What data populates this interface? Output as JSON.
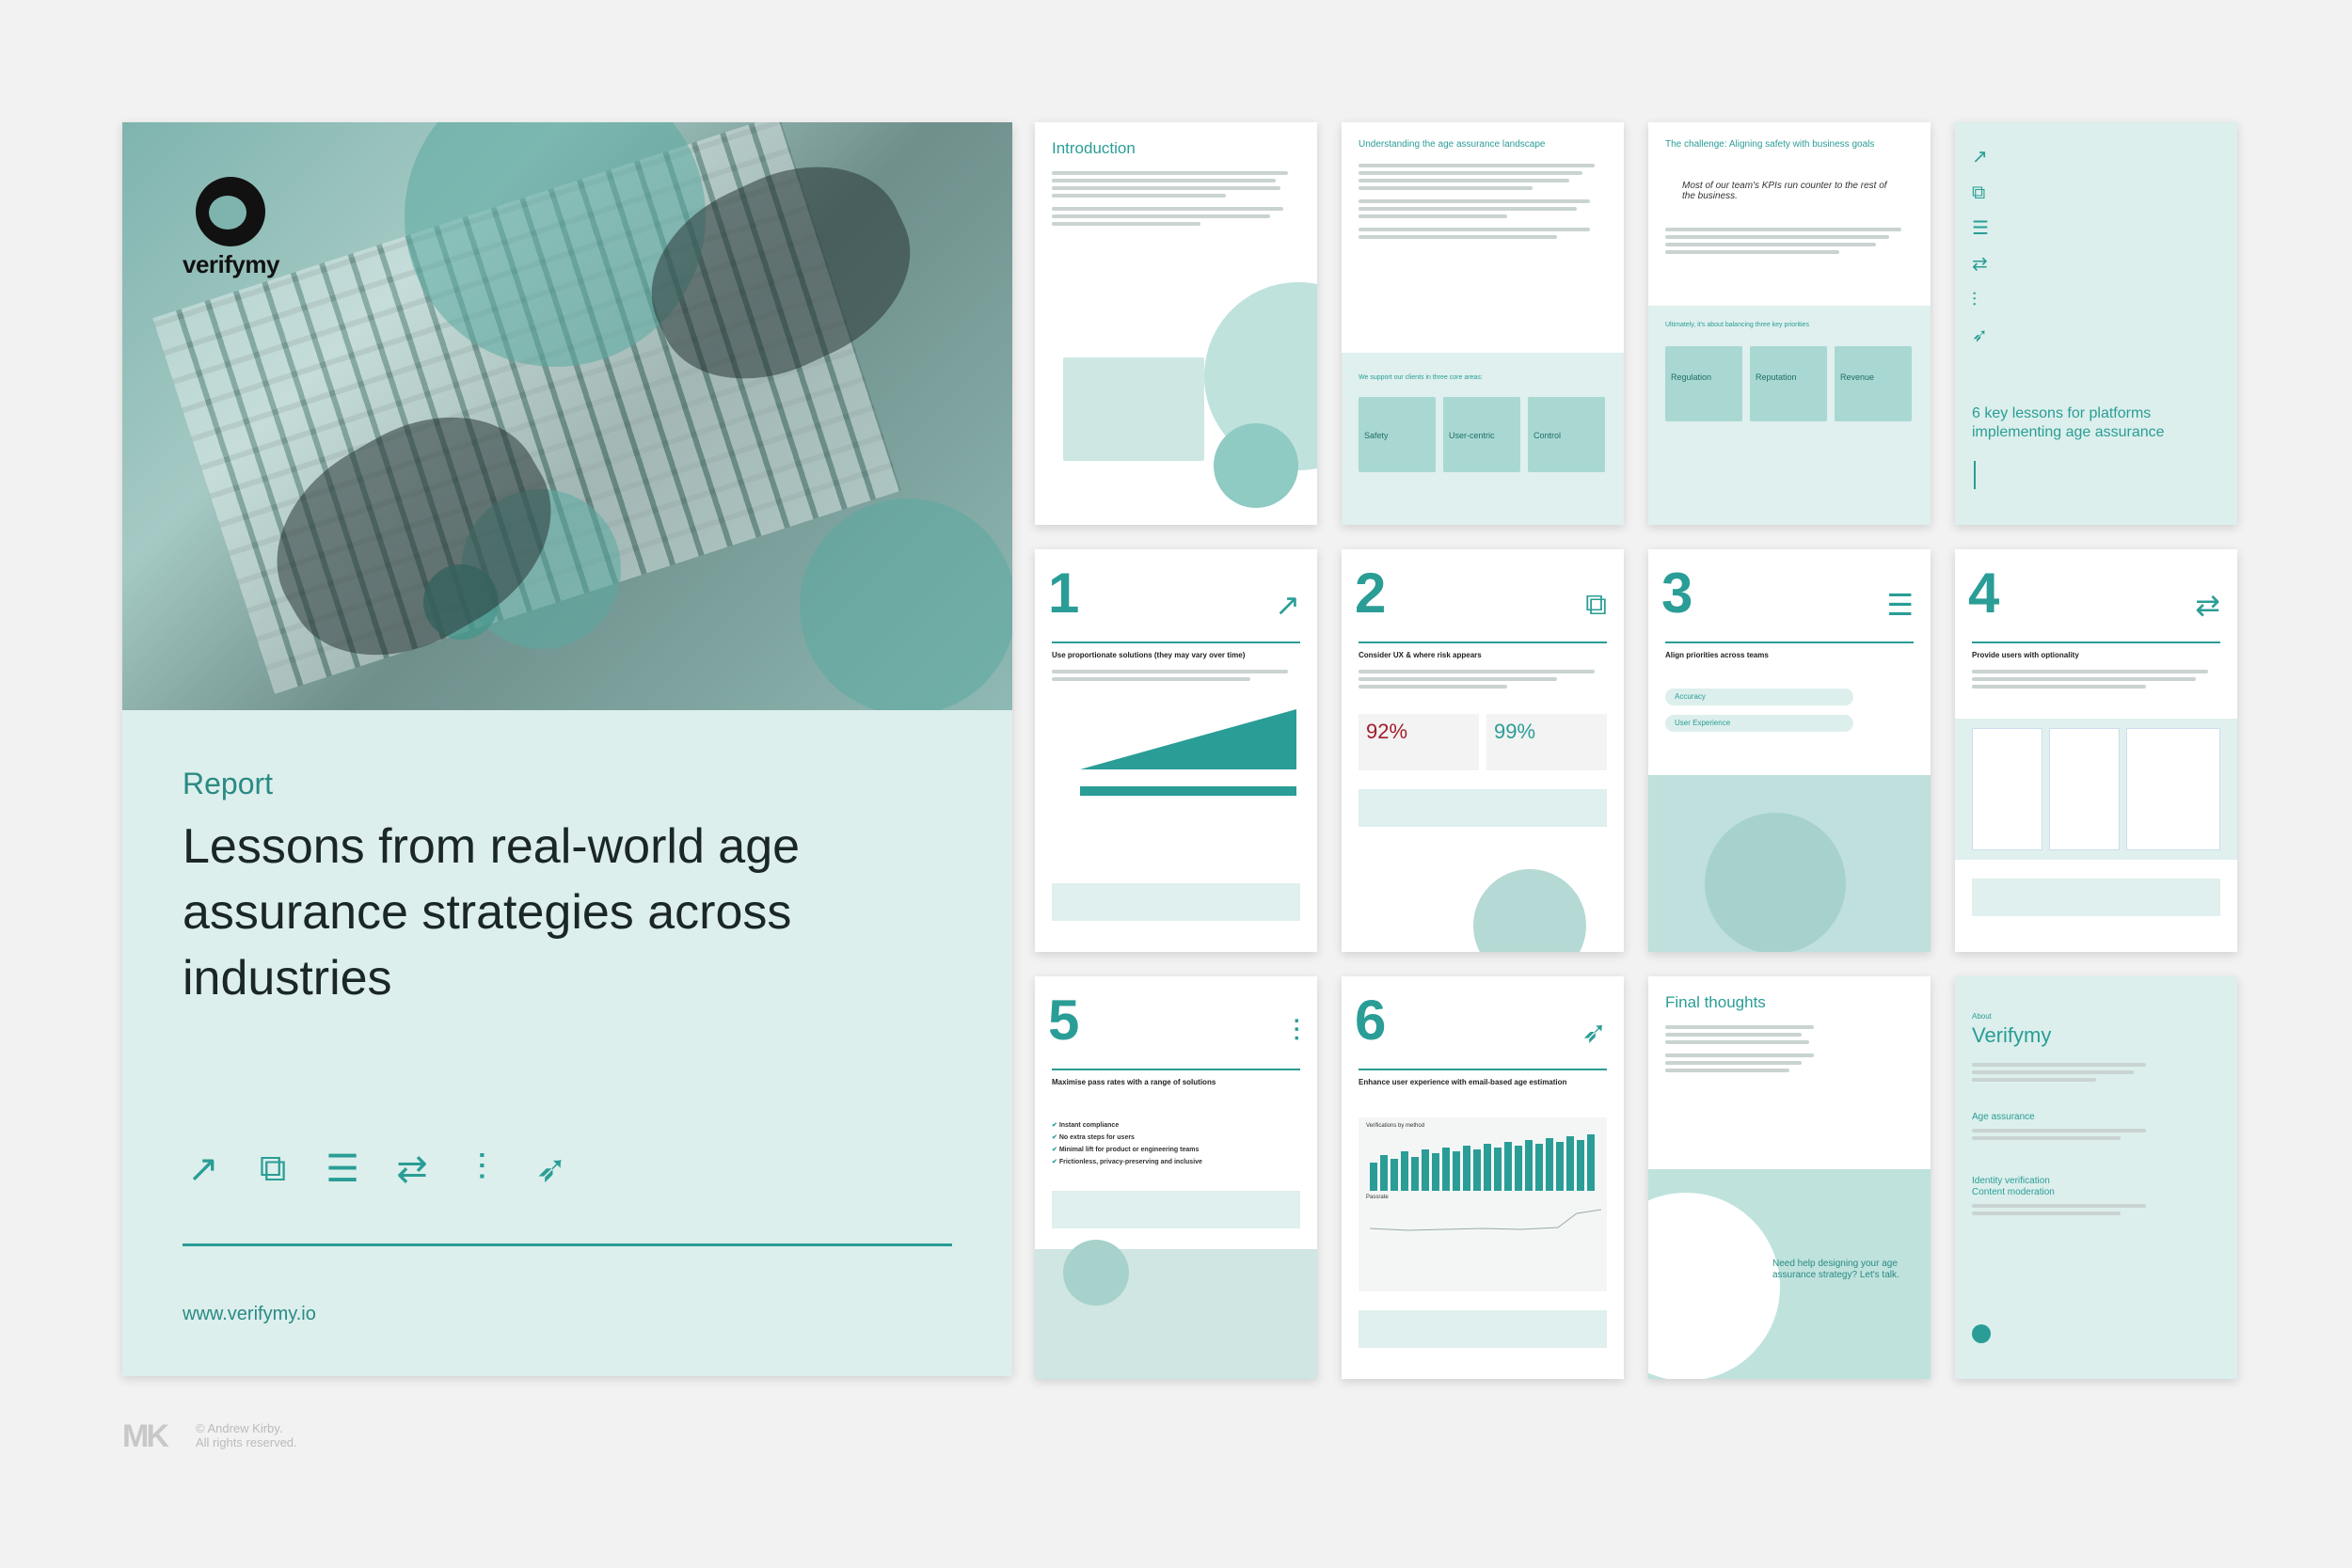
{
  "cover": {
    "brand": "verifymy",
    "label": "Report",
    "title": "Lessons from real-world age assurance strategies across industries",
    "icons": [
      "trend-up-icon",
      "flow-icon",
      "list-icon",
      "shuffle-icon",
      "sliders-icon",
      "rocket-icon"
    ],
    "url": "www.verifymy.io"
  },
  "pages": {
    "intro": {
      "heading": "Introduction"
    },
    "landscape": {
      "heading": "Understanding the age assurance landscape",
      "support": "We support our clients in three core areas:",
      "cards": [
        "Safety",
        "User-centric",
        "Control"
      ]
    },
    "challenge": {
      "heading": "The challenge: Aligning safety with business goals",
      "quote": "Most of our team's KPIs run counter to the rest of the business.",
      "balance": "Ultimately, it's about balancing three key priorities",
      "cards": [
        "Regulation",
        "Reputation",
        "Revenue"
      ]
    },
    "lessons": {
      "heading": "6 key lessons for platforms implementing age assurance"
    },
    "l1": {
      "num": "1",
      "sub": "Use proportionate solutions (they may vary over time)"
    },
    "l2": {
      "num": "2",
      "sub": "Consider UX & where risk appears",
      "stat1": "92%",
      "stat2": "99%"
    },
    "l3": {
      "num": "3",
      "sub": "Align priorities across teams",
      "a": "Accuracy",
      "b": "User Experience"
    },
    "l4": {
      "num": "4",
      "sub": "Provide users with optionality"
    },
    "l5": {
      "num": "5",
      "sub": "Maximise pass rates with a range of solutions",
      "checks": [
        "Instant compliance",
        "No extra steps for users",
        "Minimal lift for product or engineering teams",
        "Frictionless, privacy-preserving and inclusive"
      ]
    },
    "l6": {
      "num": "6",
      "sub": "Enhance user experience with email-based age estimation",
      "chart_label": "Verifications by method",
      "passrate": "Passrate"
    },
    "final": {
      "heading": "Final thoughts",
      "cta": "Need help designing your age assurance strategy? Let's talk."
    },
    "about": {
      "small": "About",
      "heading": "Verifymy",
      "s1": "Age assurance",
      "s2": "Identity verification",
      "s3": "Content moderation"
    }
  },
  "watermark": {
    "mark": "MK",
    "line1": "© Andrew Kirby.",
    "line2": "All rights reserved."
  },
  "colors": {
    "accent": "#2a9d96",
    "pale": "#dcefec"
  }
}
